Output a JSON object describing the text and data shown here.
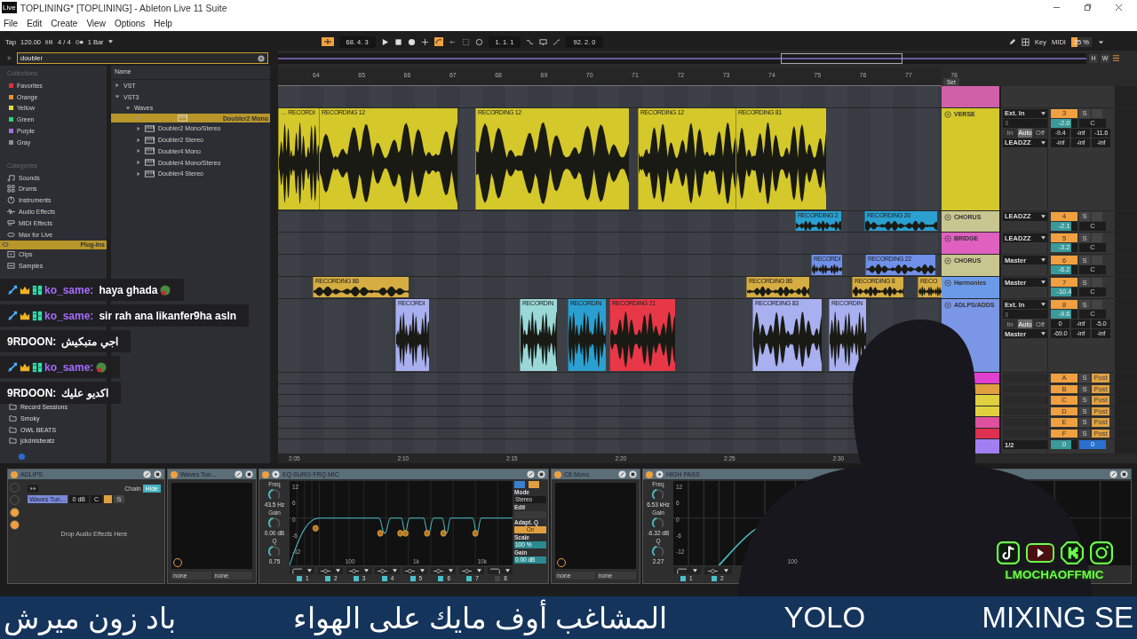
{
  "window": {
    "app_icon": "Live",
    "title": "TOPLINING*  [TOPLINING] - Ableton Live 11 Suite"
  },
  "menu": [
    "File",
    "Edit",
    "Create",
    "View",
    "Options",
    "Help"
  ],
  "transport": {
    "tap": "Tap",
    "tempo": "120.00",
    "signature": "4 / 4",
    "quantize": "1 Bar",
    "position": "68.  4.  3",
    "loop_start": "1.  1.  1",
    "loop_length": "92.  2.  0",
    "key": "Key",
    "midi": "MIDI",
    "cpu": "25 %"
  },
  "browser": {
    "search": "doubler",
    "collections_title": "Collections",
    "collections": [
      {
        "label": "Favorites",
        "color": "#e0303a"
      },
      {
        "label": "Orange",
        "color": "#e8902e"
      },
      {
        "label": "Yellow",
        "color": "#dede3c"
      },
      {
        "label": "Green",
        "color": "#30d070"
      },
      {
        "label": "Purple",
        "color": "#a070e0"
      },
      {
        "label": "Gray",
        "color": "#909090"
      }
    ],
    "categories_title": "Categories",
    "categories": [
      {
        "label": "Sounds",
        "selected": false
      },
      {
        "label": "Drums",
        "selected": false
      },
      {
        "label": "Instruments",
        "selected": false
      },
      {
        "label": "Audio Effects",
        "selected": false
      },
      {
        "label": "MIDI Effects",
        "selected": false
      },
      {
        "label": "Max for Live",
        "selected": false
      },
      {
        "label": "Plug-Ins",
        "selected": true
      },
      {
        "label": "Clips",
        "selected": false
      },
      {
        "label": "Samples",
        "selected": false
      }
    ],
    "places": [
      "Record Sessions",
      "Smoky",
      "OWL BEATS",
      "jckdnisbeatz"
    ],
    "name_header": "Name",
    "tree": [
      {
        "label": "VST",
        "expanded": false,
        "selected": false
      },
      {
        "label": "VST3",
        "expanded": true,
        "selected": false,
        "children": [
          {
            "label": "Waves",
            "expanded": true,
            "selected": false,
            "children": [
              {
                "label": "Doubler2 Mono",
                "expanded": false,
                "selected": true
              },
              {
                "label": "Doubler2 Mono/Stereo",
                "expanded": false,
                "selected": false
              },
              {
                "label": "Doubler2 Stereo",
                "expanded": false,
                "selected": false
              },
              {
                "label": "Doubler4 Mono",
                "expanded": false,
                "selected": false
              },
              {
                "label": "Doubler4 Mono/Stereo",
                "expanded": false,
                "selected": false
              },
              {
                "label": "Doubler4 Stereo",
                "expanded": false,
                "selected": false
              }
            ]
          }
        ]
      }
    ]
  },
  "arrangement": {
    "bars": [
      "64",
      "65",
      "66",
      "67",
      "68",
      "69",
      "70",
      "71",
      "72",
      "73",
      "74",
      "75",
      "76",
      "77",
      "78"
    ],
    "times": [
      "2:05",
      "2:10",
      "2:15",
      "2:20",
      "2:25",
      "2:30"
    ],
    "set_label": "Set",
    "overview_buttons": [
      "H",
      "W"
    ],
    "tracks": [
      {
        "name": "VERSE",
        "color": "#d4c82a",
        "routing": "Ext. In",
        "input_channel": "3",
        "monitor": [
          {
            "label": "In",
            "selected": false
          },
          {
            "label": "Auto",
            "selected": true
          },
          {
            "label": "Off",
            "selected": false
          }
        ],
        "output": "LEADZZ",
        "number": "3",
        "solo": "S",
        "volume": "-2.0",
        "pan": "C",
        "peaks": [
          "-9.4",
          "-inf",
          "-11.6"
        ],
        "sends": [
          "-inf",
          "-inf",
          "-inf"
        ],
        "clips": [
          {
            "name": "… RECORDI",
            "color": "#d4c82a"
          },
          {
            "name": "RECORDING 12",
            "color": "#d4c82a"
          },
          {
            "name": "RECORDING 12",
            "color": "#d4c82a"
          },
          {
            "name": "RECORDING 12",
            "color": "#d4c82a"
          },
          {
            "name": "RECORDING 81",
            "color": "#d4c82a"
          }
        ]
      },
      {
        "name": "CHORUS",
        "color": "#c8c690",
        "routing": "LEADZZ",
        "number": "4",
        "solo": "S",
        "volume": "-2.1",
        "pan": "C",
        "clips": [
          {
            "name": "RECORDING 2",
            "color": "#2a9fd0"
          },
          {
            "name": "RECORDING 20",
            "color": "#2a9fd0"
          }
        ]
      },
      {
        "name": "BRIDGE",
        "color": "#e060c0",
        "routing": "LEADZZ",
        "number": "5",
        "solo": "S",
        "volume": "-3.2",
        "pan": "C"
      },
      {
        "name": "CHORUS",
        "color": "#c8c690",
        "routing": "Master",
        "number": "6",
        "solo": "S",
        "volume": "-6.2",
        "pan": "C",
        "clips": [
          {
            "name": "RECORDI",
            "color": "#6f8fe8"
          },
          {
            "name": "RECORDING 22",
            "color": "#6f8fe8"
          }
        ]
      },
      {
        "name": "Harmonies",
        "color": "#6b9be8",
        "routing": "Master",
        "number": "7",
        "solo": "S",
        "volume": "-10.4",
        "pan": "C",
        "clips": [
          {
            "name": "RECORDING 86",
            "color": "#d6ad42"
          },
          {
            "name": "RECORDING 86",
            "color": "#d6ad42"
          },
          {
            "name": "RECORDING 8",
            "color": "#d6ad42"
          },
          {
            "name": "RECO",
            "color": "#d6ad42"
          }
        ]
      },
      {
        "name": "ADLPS/ADDS",
        "color": "#7b96e6",
        "routing": "Ext. In",
        "input_channel": "3",
        "monitor": [
          {
            "label": "In",
            "selected": false
          },
          {
            "label": "Auto",
            "selected": true
          },
          {
            "label": "Off",
            "selected": false
          }
        ],
        "output": "Master",
        "number": "8",
        "solo": "S",
        "volume": "-9.6",
        "pan": "C",
        "peaks": [
          "0",
          "-inf",
          "-5.0"
        ],
        "sends": [
          "-69.0",
          "-inf",
          "-inf"
        ],
        "clips": [
          {
            "name": "RECORDI",
            "color": "#a8b0f0"
          },
          {
            "name": "RECORDIN",
            "color": "#9ad8d8"
          },
          {
            "name": "RECORDIN",
            "color": "#2a9fd0"
          },
          {
            "name": "RECORDING 21",
            "color": "#e83848"
          },
          {
            "name": "RECORDING 83",
            "color": "#a8b0f0"
          },
          {
            "name": "RECORDIN",
            "color": "#a8b0f0"
          }
        ]
      }
    ],
    "returns": [
      {
        "letter": "A",
        "color": "#e040d0",
        "solo": "S",
        "mode": "Post"
      },
      {
        "letter": "B",
        "color": "#e0a040",
        "solo": "S",
        "mode": "Post"
      },
      {
        "letter": "C",
        "color": "#e0d040",
        "solo": "S",
        "mode": "Post"
      },
      {
        "letter": "D",
        "color": "#e0d040",
        "solo": "S",
        "mode": "Post"
      },
      {
        "letter": "E",
        "color": "#e050a0",
        "solo": "S",
        "mode": "Post"
      },
      {
        "letter": "F",
        "color": "#e03050",
        "solo": "S",
        "mode": "Post"
      }
    ],
    "master": {
      "color": "#a080f0",
      "output": "1/2",
      "volume": "0",
      "pan": "0"
    }
  },
  "devices": [
    {
      "kind": "rack",
      "title": "ADLIPS",
      "chain": "Chain",
      "hide": "Hide",
      "chain_name": "Waves Tun...",
      "chain_volume": "0 dB",
      "chain_pan": "C",
      "solo": "S",
      "drop_hint": "Drop Audio Effects Here"
    },
    {
      "kind": "plugin",
      "title": "Waves Tun...",
      "slots": [
        "none",
        "none"
      ]
    },
    {
      "kind": "eq",
      "title": "EQ SURG FRQ MIC",
      "freq_label": "Freq",
      "freq": "43.5 Hz",
      "gain_label": "Gain",
      "gain": "0.00 dB",
      "q_label": "Q",
      "q": "0.75",
      "y_labels": [
        "12",
        "6",
        "0",
        "-6",
        "-12"
      ],
      "x_labels": [
        "100",
        "1k",
        "10k"
      ],
      "bands": [
        {
          "label": "1",
          "on": true
        },
        {
          "label": "2",
          "on": true
        },
        {
          "label": "3",
          "on": true
        },
        {
          "label": "4",
          "on": true
        },
        {
          "label": "5",
          "on": true
        },
        {
          "label": "6",
          "on": true
        },
        {
          "label": "7",
          "on": true
        },
        {
          "label": "8",
          "on": false
        }
      ],
      "side": {
        "mode_label": "Mode",
        "mode": "Stereo",
        "edit_label": "Edit",
        "adapt_label": "Adapt. Q",
        "adapt": "On",
        "scale_label": "Scale",
        "scale": "100 %",
        "gain_label": "Gain",
        "gain": "0.00 dB"
      }
    },
    {
      "kind": "plugin",
      "title": "C6 Mono",
      "slots": [
        "none",
        "none"
      ]
    },
    {
      "kind": "eq",
      "title": "HIGH PASS",
      "freq_label": "Freq",
      "freq": "6.53 kHz",
      "gain_label": "Gain",
      "gain": "-6.32 dB",
      "q_label": "Q",
      "q": "2.27",
      "y_labels": [
        "12",
        "6",
        "0",
        "-6",
        "-12"
      ],
      "x_labels": [
        "100"
      ],
      "bands": [
        {
          "label": "1",
          "on": true
        },
        {
          "label": "2",
          "on": true
        }
      ]
    }
  ],
  "chat": [
    {
      "user": "ko_same:",
      "color": "#a66bff",
      "badges": true,
      "message": "haya ghada",
      "emote": true
    },
    {
      "user": "ko_same:",
      "color": "#a66bff",
      "badges": true,
      "message": "sir rah ana likanfer9ha asln",
      "emote": false
    },
    {
      "user": "9RDOON:",
      "color": "#ffffff",
      "badges": false,
      "message": "اجي متبكيش",
      "emote": false
    },
    {
      "user": "ko_same:",
      "color": "#a66bff",
      "badges": true,
      "emote": true
    },
    {
      "user": "9RDOON:",
      "color": "#ffffff",
      "badges": false,
      "message": "اكديو عليك",
      "emote": false
    }
  ],
  "overlay": {
    "handle": "LMOCHAOFFMIC"
  },
  "ticker": [
    "باد زون ميرش",
    "المشاغب أوف مايك على الهواء",
    "YOLO",
    "MIXING SE"
  ]
}
